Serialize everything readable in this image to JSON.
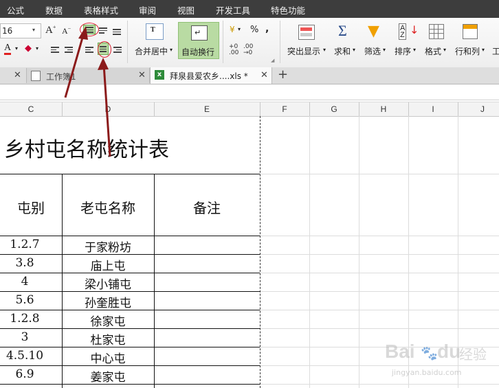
{
  "menubar": {
    "items": [
      "公式",
      "数据",
      "表格样式",
      "审阅",
      "视图",
      "开发工具",
      "特色功能"
    ]
  },
  "ribbon": {
    "font_size": "16",
    "merge_center": "合并居中",
    "auto_wrap": "自动换行",
    "percent": "%",
    "comma": ",",
    "highlight": "突出显示",
    "sum": "求和",
    "filter": "筛选",
    "sort": "排序",
    "format": "格式",
    "rows_cols": "行和列",
    "worksheet_cut": "工"
  },
  "tabs": {
    "tab1": "工作簿1",
    "tab2": "拜泉县爱农乡....xls *",
    "add": "+"
  },
  "columns": [
    "C",
    "D",
    "E",
    "F",
    "G",
    "H",
    "I",
    "J"
  ],
  "sheet": {
    "title": "乡村屯名称统计表",
    "headers": [
      "屯别",
      "老屯名称",
      "备注"
    ],
    "rows": [
      {
        "tun": "1.2.7",
        "name": "于家粉坊"
      },
      {
        "tun": "3.8",
        "name": "庙上屯"
      },
      {
        "tun": "4",
        "name": "梁小铺屯"
      },
      {
        "tun": "5.6",
        "name": "孙奎胜屯"
      },
      {
        "tun": "1.2.8",
        "name": "徐家屯"
      },
      {
        "tun": "3",
        "name": "杜家屯"
      },
      {
        "tun": "4.5.10",
        "name": "中心屯"
      },
      {
        "tun": "6.9",
        "name": "姜家屯"
      }
    ]
  },
  "watermark": {
    "brand": "Bai",
    "brand2": "du",
    "cn": "经验",
    "url": "jingyan.baidu.com"
  },
  "colors": {
    "menubar": "#3d3d3d",
    "annotation": "#8b1a1a",
    "highlight_green": "#b9dba3"
  }
}
